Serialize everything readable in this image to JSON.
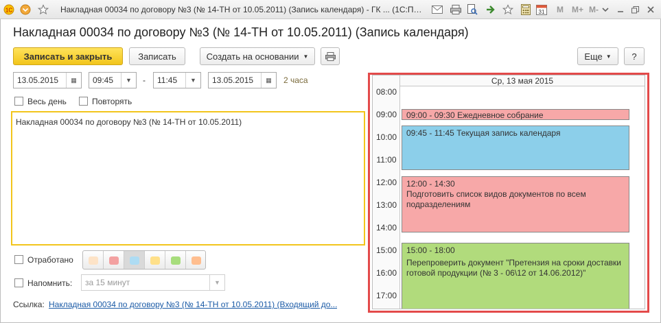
{
  "app": {
    "window_title": "Накладная 00034 по договору №3 (№ 14-ТН от 10.05.2011) (Запись календаря) - ГК ... (1С:Предприятие)",
    "toolbar_right": [
      "М",
      "М+",
      "М-"
    ]
  },
  "form": {
    "title": "Накладная 00034 по договору №3 (№ 14-ТН от 10.05.2011) (Запись календаря)",
    "buttons": {
      "save_close": "Записать и закрыть",
      "save": "Записать",
      "create_based": "Создать на основании",
      "more": "Еще",
      "help": "?"
    },
    "start_date": "13.05.2015",
    "start_time": "09:45",
    "dash": "-",
    "end_time": "11:45",
    "end_date": "13.05.2015",
    "duration": "2 часа",
    "all_day": "Весь день",
    "repeat": "Повторять",
    "description": "Накладная 00034 по договору №3 (№ 14-ТН от 10.05.2011)",
    "done": "Отработано",
    "remind": "Напомнить:",
    "remind_value": "за 15 минут",
    "link_label": "Ссылка:",
    "link_text": "Накладная 00034 по договору №3 (№ 14-ТН от 10.05.2011) (Входящий до...",
    "colors": [
      "#fde3c7",
      "#f3a1a1",
      "#aedcf3",
      "#ffe089",
      "#a7dd7c",
      "#ffbe8f"
    ]
  },
  "calendar": {
    "day_header": "Ср, 13 мая 2015",
    "hours": [
      "08:00",
      "09:00",
      "10:00",
      "11:00",
      "12:00",
      "13:00",
      "14:00",
      "15:00",
      "16:00",
      "17:00"
    ],
    "events": [
      {
        "time": "09:00 - 09:30",
        "text": "Ежедневное собрание",
        "color": "#f7a8a8"
      },
      {
        "time": "09:45 - 11:45",
        "text": "Текущая запись календаря",
        "color": "#8ccfea"
      },
      {
        "time": "12:00 - 14:30",
        "text": "Подготовить список видов документов по всем подразделениям",
        "color": "#f7a8a8"
      },
      {
        "time": "15:00 - 18:00",
        "text": "Перепроверить документ \"Претензия на сроки доставки готовой продукции (№ 3 - 06\\12 от 14.06.2012)\"",
        "color": "#b1db7c"
      }
    ]
  }
}
